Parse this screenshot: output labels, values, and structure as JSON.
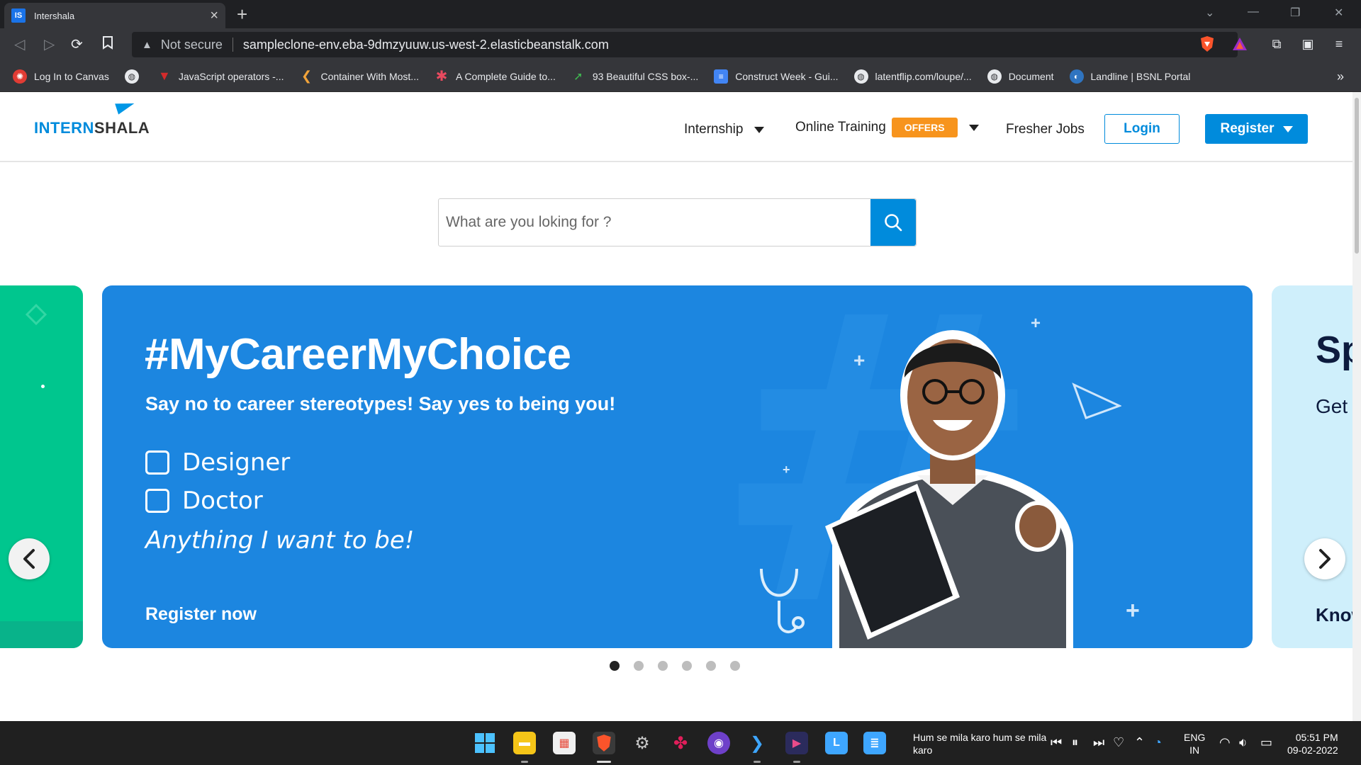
{
  "browser": {
    "tab_title": "Intershala",
    "tab_favicon": "IS",
    "not_secure": "Not secure",
    "url": "sampleclone-env.eba-9dmzyuuw.us-west-2.elasticbeanstalk.com",
    "bookmarks": [
      {
        "label": "Log In to Canvas",
        "icon": "canvas-icon",
        "color": "#e13c34"
      },
      {
        "label": "",
        "icon": "globe-icon",
        "color": "#e8eaed"
      },
      {
        "label": "JavaScript operators -...",
        "icon": "tutorialspoint-icon",
        "color": "#d42b2b"
      },
      {
        "label": "Container With Most...",
        "icon": "leetcode-icon",
        "color": "#f2a43a"
      },
      {
        "label": "A Complete Guide to...",
        "icon": "asterisk-icon",
        "color": "#e84a5f"
      },
      {
        "label": "93 Beautiful CSS box-...",
        "icon": "cursor-icon",
        "color": "#3fb950"
      },
      {
        "label": "Construct Week - Gui...",
        "icon": "docs-icon",
        "color": "#4285f4"
      },
      {
        "label": "latentflip.com/loupe/...",
        "icon": "globe-icon",
        "color": "#e8eaed"
      },
      {
        "label": "Document",
        "icon": "globe-icon",
        "color": "#e8eaed"
      },
      {
        "label": "Landline | BSNL Portal",
        "icon": "bsnl-icon",
        "color": "#2f74c0"
      }
    ],
    "more": "»"
  },
  "site": {
    "logo_prefix": "INTERN",
    "logo_suffix": "SHALA",
    "nav": {
      "internship": "Internship",
      "online_training": "Online Training",
      "offers": "OFFERS",
      "fresher_jobs": "Fresher Jobs",
      "login": "Login",
      "register": "Register"
    },
    "search": {
      "placeholder": "What are you loking for ?"
    }
  },
  "carousel": {
    "main": {
      "title": "#MyCareerMyChoice",
      "subtitle": "Say no to career stereotypes! Say yes to being you!",
      "options": [
        "Designer",
        "Doctor"
      ],
      "tagline": "Anything I want to be!",
      "cta": "Register now",
      "bg_color": "#1c86e0"
    },
    "next_peek": {
      "title": "Sp",
      "subtitle": "Get",
      "cta": "Know"
    },
    "dots_total": 6,
    "active_dot": 0
  },
  "taskbar": {
    "media": "Hum se mila karo hum se mila karo",
    "lang_line1": "ENG",
    "lang_line2": "IN",
    "time": "05:51 PM",
    "date": "09-02-2022"
  }
}
